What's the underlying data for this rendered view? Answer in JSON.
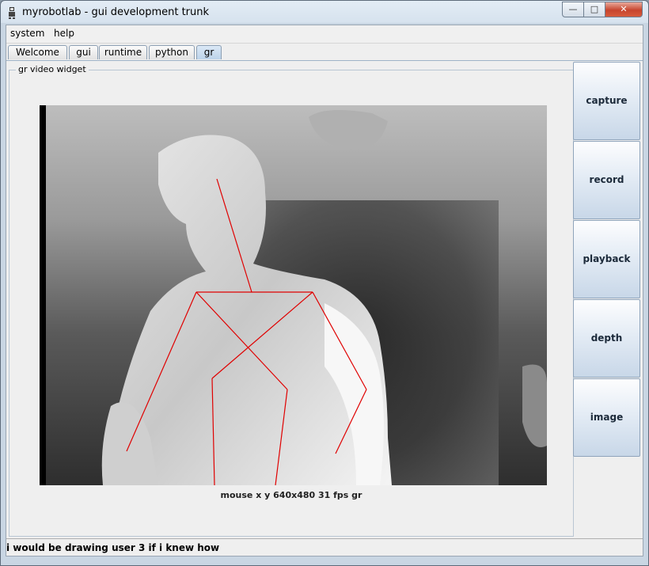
{
  "window": {
    "title": "myrobotlab - gui development trunk"
  },
  "window_buttons": {
    "minimize": "—",
    "maximize": "□",
    "close": "✕"
  },
  "menu": [
    "system",
    "help"
  ],
  "tabs": [
    "Welcome",
    "gui",
    "runtime",
    "python",
    "gr"
  ],
  "active_tab": "gr",
  "panel": {
    "title": "gr  video widget"
  },
  "video": {
    "caption": "mouse x y  640x480  31 fps  gr"
  },
  "side_buttons": [
    "capture",
    "record",
    "playback",
    "depth",
    "image"
  ],
  "status": {
    "text": "i would be drawing user 3 if i knew how"
  },
  "colors": {
    "skeleton": "#e00000",
    "title_close": "#c7452d",
    "active_tab": "#bcd3ea"
  }
}
